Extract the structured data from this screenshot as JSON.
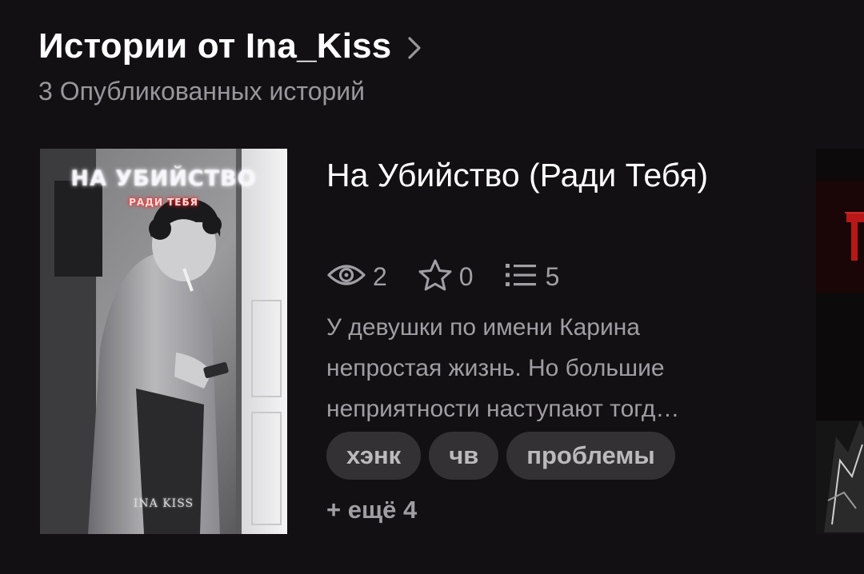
{
  "section": {
    "title": "Истории от Ina_Kiss",
    "subtitle": "3 Опубликованных историй"
  },
  "story": {
    "title": "На Убийство (Ради Тебя)",
    "cover": {
      "title_text": "НА УБИЙСТВО",
      "subtitle_text": "РАДИ ТЕБЯ",
      "author_text": "INA KISS"
    },
    "stats": {
      "views": "2",
      "votes": "0",
      "parts": "5"
    },
    "description_lines": [
      "У девушки по имени Карина",
      "непростая жизнь. Но большие",
      "неприятности наступают тогд…"
    ],
    "tags": [
      "хэнк",
      "чв",
      "проблемы"
    ],
    "more_tags": "+ ещё 4"
  },
  "icons": {
    "header_chevron": "chevron-right-icon",
    "views": "eye-icon",
    "votes": "star-icon",
    "parts": "list-icon"
  },
  "colors": {
    "background": "#121013",
    "text_primary": "#ffffff",
    "text_secondary": "#a19ea3",
    "tag_background": "#343135"
  }
}
